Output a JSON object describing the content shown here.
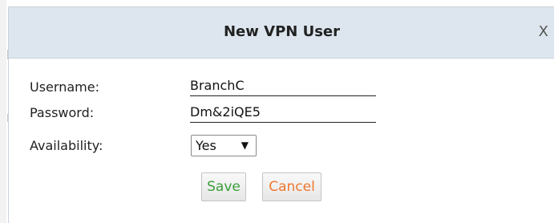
{
  "dialog": {
    "title": "New VPN User",
    "close_label": "X"
  },
  "form": {
    "username_label": "Username:",
    "username_value": "BranchC",
    "password_label": "Password:",
    "password_value": "Dm&2iQE5",
    "availability_label": "Availability:",
    "availability_value": "Yes",
    "availability_caret": "▼"
  },
  "buttons": {
    "save_label": "Save",
    "save_color": "#3a9e3a",
    "cancel_label": "Cancel",
    "cancel_color": "#f07830"
  },
  "colors": {
    "titlebar_bg": "#dde6ee"
  }
}
